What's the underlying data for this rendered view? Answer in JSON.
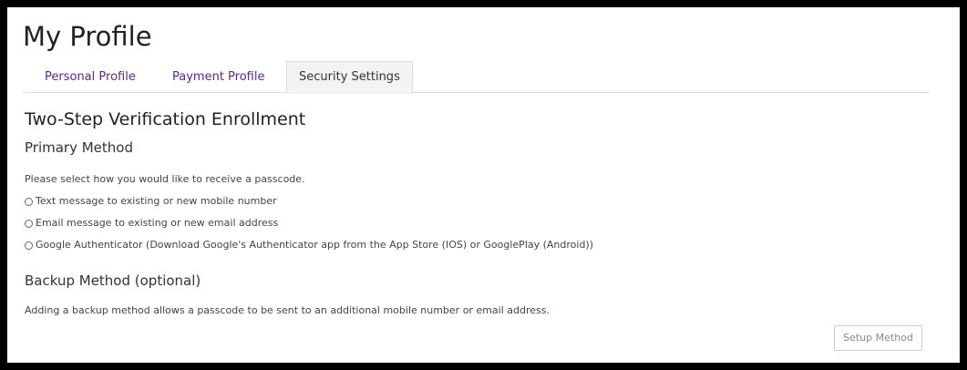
{
  "page": {
    "title": "My Profile"
  },
  "tabs": [
    {
      "label": "Personal Profile",
      "active": false
    },
    {
      "label": "Payment Profile",
      "active": false
    },
    {
      "label": "Security Settings",
      "active": true
    }
  ],
  "enrollment": {
    "title": "Two-Step Verification Enrollment",
    "primary": {
      "heading": "Primary Method",
      "instructions": "Please select how you would like to receive a passcode.",
      "options": [
        {
          "label": "Text message to existing or new mobile number",
          "selected": false
        },
        {
          "label": "Email message to existing or new email address",
          "selected": false
        },
        {
          "label": "Google Authenticator (Download Google's Authenticator app from the App Store (IOS) or GooglePlay (Android))",
          "selected": false
        }
      ]
    },
    "backup": {
      "heading": "Backup Method (optional)",
      "description": "Adding a backup method allows a passcode to be sent to an additional mobile number or email address.",
      "setup_button_label": "Setup Method"
    }
  },
  "colors": {
    "tab_link": "#5b2a82",
    "active_tab_bg": "#f3f3f3",
    "border": "#dddddd",
    "frame": "#000000"
  }
}
